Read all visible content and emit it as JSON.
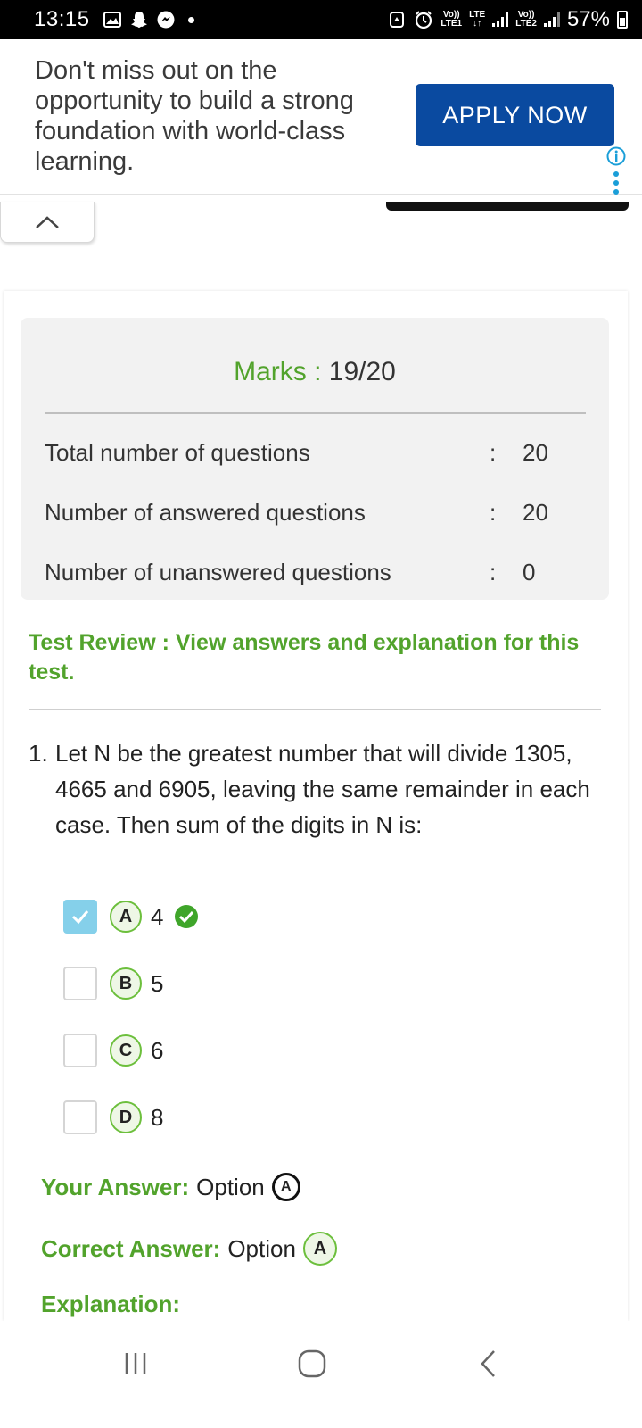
{
  "status_bar": {
    "time": "13:15",
    "net1_top": "Vo))",
    "net1_bottom": "LTE1",
    "net_lte": "LTE",
    "net2_top": "Vo))",
    "net2_bottom": "LTE2",
    "battery": "57%",
    "icons": [
      "gallery-icon",
      "snapchat-icon",
      "messenger-icon",
      "notification-dot",
      "recycle-icon",
      "alarm-icon",
      "signal-icon",
      "battery-icon"
    ]
  },
  "ad": {
    "text": "Don't miss out on the opportunity to build a strong foundation with world-class learning.",
    "button": "APPLY NOW",
    "accent": "#0a4aa0"
  },
  "result": {
    "marks_label": "Marks :",
    "marks_value": "19/20",
    "stats": [
      {
        "label": "Total number of questions",
        "colon": ":",
        "value": "20"
      },
      {
        "label": "Number of answered questions",
        "colon": ":",
        "value": "20"
      },
      {
        "label": "Number of unanswered questions",
        "colon": ":",
        "value": "0"
      }
    ]
  },
  "review": {
    "heading": "Test Review : View answers and explanation for this test."
  },
  "question": {
    "number": "1.",
    "text": "Let N be the greatest number that will divide 1305, 4665 and 6905, leaving the same remainder in each case. Then sum of the digits in N is:",
    "options": [
      {
        "letter": "A",
        "value": "4",
        "selected": true,
        "correct": true
      },
      {
        "letter": "B",
        "value": "5",
        "selected": false,
        "correct": false
      },
      {
        "letter": "C",
        "value": "6",
        "selected": false,
        "correct": false
      },
      {
        "letter": "D",
        "value": "8",
        "selected": false,
        "correct": false
      }
    ],
    "your_answer_label": "Your Answer:",
    "your_answer_text": "Option",
    "your_answer_letter": "A",
    "correct_answer_label": "Correct Answer:",
    "correct_answer_text": "Option",
    "correct_answer_letter": "A",
    "explanation_label": "Explanation:"
  },
  "colors": {
    "green": "#52a32c",
    "checkbox_selected": "#85d0ea"
  }
}
